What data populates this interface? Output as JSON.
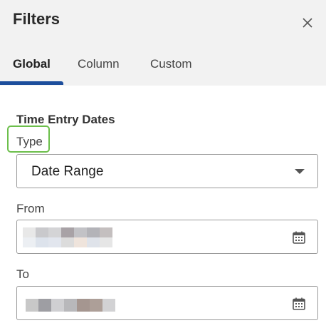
{
  "header": {
    "title": "Filters",
    "close_glyph": "×",
    "background": "#f2f2f2"
  },
  "tabs": [
    {
      "label": "Global",
      "active": true
    },
    {
      "label": "Column",
      "active": false
    },
    {
      "label": "Custom",
      "active": false
    }
  ],
  "accent_color": "#1d4e9c",
  "highlight_color": "#6cbf4b",
  "section": {
    "title": "Time Entry Dates",
    "type_label": "Type",
    "type_value": "Date Range",
    "from_label": "From",
    "to_label": "To"
  },
  "icons": {
    "close": "close-icon",
    "dropdown": "chevron-down-icon",
    "calendar": "calendar-icon"
  }
}
